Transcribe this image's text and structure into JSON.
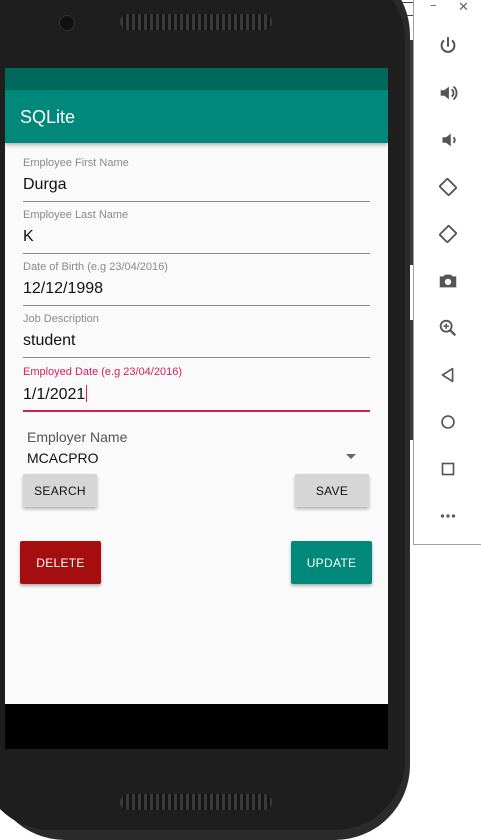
{
  "app": {
    "title": "SQLite"
  },
  "form": {
    "first_name": {
      "label": "Employee First Name",
      "value": "Durga"
    },
    "last_name": {
      "label": "Employee Last Name",
      "value": "K"
    },
    "dob": {
      "label": "Date of Birth (e.g 23/04/2016)",
      "value": "12/12/1998"
    },
    "job": {
      "label": "Job Description",
      "value": "student"
    },
    "employed": {
      "label": "Employed Date (e.g 23/04/2016)",
      "value": "1/1/2021"
    },
    "employer": {
      "label": "Employer Name",
      "value": "MCACPRO"
    }
  },
  "buttons": {
    "search": "SEARCH",
    "save": "SAVE",
    "delete": "DELETE",
    "update": "UPDATE"
  },
  "colors": {
    "primary": "#00897b",
    "primary_dark": "#00695c",
    "accent": "#d81b60",
    "delete": "#a50e0e"
  },
  "toolbar": {
    "window_controls": [
      "minimize",
      "close"
    ],
    "icons": [
      "power-icon",
      "volume-up-icon",
      "volume-down-icon",
      "rotate-left-icon",
      "rotate-right-icon",
      "camera-icon",
      "zoom-icon",
      "back-icon",
      "home-icon",
      "overview-icon",
      "more-icon"
    ]
  }
}
